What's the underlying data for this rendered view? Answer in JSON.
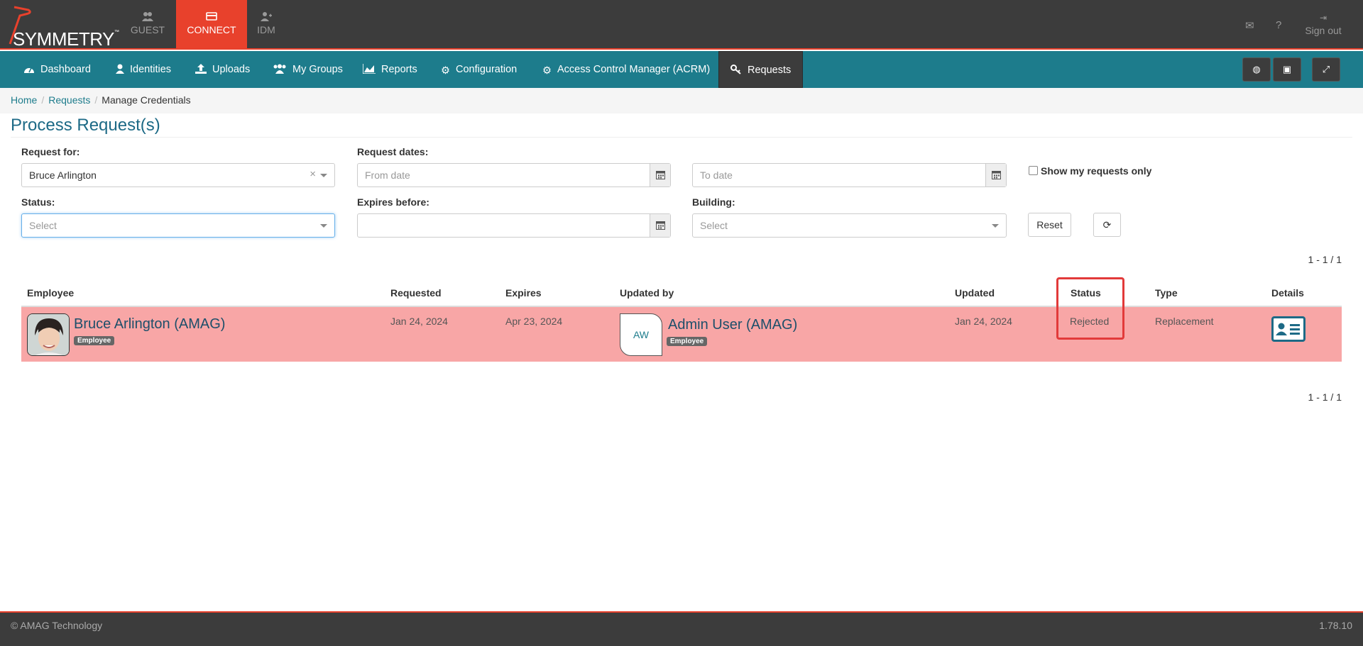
{
  "brand": {
    "logo_text": "SYMMETRY",
    "tm": "™"
  },
  "app_tabs": [
    {
      "label": "GUEST",
      "icon": "users-icon"
    },
    {
      "label": "CONNECT",
      "icon": "credit-card-icon",
      "active": true
    },
    {
      "label": "IDM",
      "icon": "user-plus-icon"
    }
  ],
  "top_right": {
    "mail_icon": "envelope-icon",
    "help_icon": "question-icon",
    "signout_label": "Sign out"
  },
  "nav": {
    "items": [
      {
        "label": "Dashboard",
        "icon": "dashboard-icon"
      },
      {
        "label": "Identities",
        "icon": "user-icon"
      },
      {
        "label": "Uploads",
        "icon": "upload-icon"
      },
      {
        "label": "My Groups",
        "icon": "group-icon"
      },
      {
        "label": "Reports",
        "icon": "area-chart-icon"
      },
      {
        "label": "Configuration",
        "icon": "gear-icon"
      },
      {
        "label": "Access Control Manager (ACRM)",
        "icon": "gear-icon"
      },
      {
        "label": "Requests",
        "icon": "key-icon",
        "active": true
      }
    ],
    "right_buttons": [
      "globe-icon",
      "lock-icon",
      "expand-icon"
    ]
  },
  "breadcrumb": {
    "home": "Home",
    "requests": "Requests",
    "current": "Manage Credentials"
  },
  "page_title": "Process Request(s)",
  "filters": {
    "request_for_label": "Request for:",
    "request_for_value": "Bruce Arlington",
    "clear": "×",
    "request_dates_label": "Request dates:",
    "from_placeholder": "From date",
    "to_placeholder": "To date",
    "show_mine_label": "Show my requests only",
    "status_label": "Status:",
    "status_placeholder": "Select",
    "expires_label": "Expires before:",
    "building_label": "Building:",
    "building_placeholder": "Select",
    "reset_label": "Reset",
    "refresh_icon": "refresh-icon"
  },
  "pager": {
    "top": "1 - 1 / 1",
    "bottom": "1 - 1 / 1"
  },
  "table": {
    "headers": [
      "Employee",
      "Requested",
      "Expires",
      "Updated by",
      "Updated",
      "Status",
      "Type",
      "Details"
    ],
    "rows": [
      {
        "employee": "Bruce Arlington (AMAG)",
        "employee_badge": "Employee",
        "requested": "Jan 24, 2024",
        "expires": "Apr 23, 2024",
        "updated_by_initials": "AW",
        "updated_by": "Admin User (AMAG)",
        "updated_by_badge": "Employee",
        "updated": "Jan 24, 2024",
        "status": "Rejected",
        "type": "Replacement",
        "details_icon": "id-card-icon",
        "row_color": "#f8a6a6"
      }
    ]
  },
  "footer": {
    "copyright": "© AMAG Technology",
    "version": "1.78.10"
  },
  "colors": {
    "accent": "#1d7c8c",
    "brand_red": "#e8412c",
    "dark": "#3c3c3c",
    "highlight": "#e23a3a"
  }
}
